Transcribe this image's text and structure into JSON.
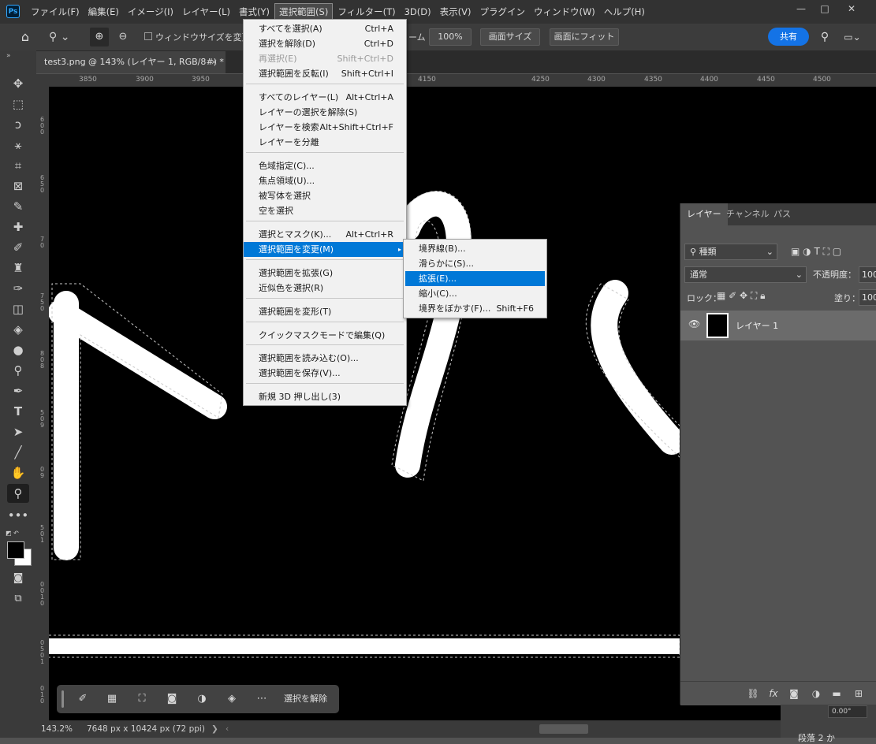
{
  "menubar": {
    "items": [
      "ファイル(F)",
      "編集(E)",
      "イメージ(I)",
      "レイヤー(L)",
      "書式(Y)",
      "選択範囲(S)",
      "フィルター(T)",
      "3D(D)",
      "表示(V)",
      "プラグイン",
      "ウィンドウ(W)",
      "ヘルプ(H)"
    ],
    "window_controls": [
      "—",
      "□",
      "✕"
    ]
  },
  "options": {
    "resize_windows_label": "ウィンドウサイズを変更",
    "truncated_label": "ーム",
    "zoom_value": "100%",
    "fit_screen_label": "画面サイズ",
    "fill_screen_label": "画面にフィット",
    "share_label": "共有"
  },
  "document_tab": {
    "title": "test3.png @ 143% (レイヤー 1, RGB/8#) *",
    "close": "×"
  },
  "ruler": {
    "top": [
      "3850",
      "3900",
      "3950",
      "4150",
      "4250",
      "4300",
      "4350",
      "4400",
      "4450",
      "4500"
    ],
    "left": [
      "6",
      "0",
      "0",
      "6",
      "5",
      "0",
      "7",
      "0",
      "7",
      "5",
      "0",
      "8",
      "0",
      "8",
      "5",
      "0",
      "9",
      "0",
      "9",
      "5",
      "0",
      "1",
      "0",
      "0",
      "1",
      "0",
      "0",
      "5",
      "0",
      "1",
      "0",
      "1",
      "0"
    ]
  },
  "select_menu": {
    "items": [
      {
        "label": "すべてを選択(A)",
        "shortcut": "Ctrl+A"
      },
      {
        "label": "選択を解除(D)",
        "shortcut": "Ctrl+D"
      },
      {
        "label": "再選択(E)",
        "shortcut": "Shift+Ctrl+D"
      },
      {
        "label": "選択範囲を反転(I)",
        "shortcut": "Shift+Ctrl+I"
      },
      {
        "label": "すべてのレイヤー(L)",
        "shortcut": "Alt+Ctrl+A"
      },
      {
        "label": "レイヤーの選択を解除(S)",
        "shortcut": ""
      },
      {
        "label": "レイヤーを検索",
        "shortcut": "Alt+Shift+Ctrl+F"
      },
      {
        "label": "レイヤーを分離",
        "shortcut": ""
      },
      {
        "label": "色域指定(C)...",
        "shortcut": ""
      },
      {
        "label": "焦点領域(U)...",
        "shortcut": ""
      },
      {
        "label": "被写体を選択",
        "shortcut": ""
      },
      {
        "label": "空を選択",
        "shortcut": ""
      },
      {
        "label": "選択とマスク(K)...",
        "shortcut": "Alt+Ctrl+R"
      },
      {
        "label": "選択範囲を変更(M)",
        "shortcut": "▸"
      },
      {
        "label": "選択範囲を拡張(G)",
        "shortcut": ""
      },
      {
        "label": "近似色を選択(R)",
        "shortcut": ""
      },
      {
        "label": "選択範囲を変形(T)",
        "shortcut": ""
      },
      {
        "label": "クイックマスクモードで編集(Q)",
        "shortcut": ""
      },
      {
        "label": "選択範囲を読み込む(O)...",
        "shortcut": ""
      },
      {
        "label": "選択範囲を保存(V)...",
        "shortcut": ""
      },
      {
        "label": "新規 3D 押し出し(3)",
        "shortcut": ""
      }
    ]
  },
  "modify_submenu": {
    "items": [
      {
        "label": "境界線(B)...",
        "shortcut": ""
      },
      {
        "label": "滑らかに(S)...",
        "shortcut": ""
      },
      {
        "label": "拡張(E)...",
        "shortcut": ""
      },
      {
        "label": "縮小(C)...",
        "shortcut": ""
      },
      {
        "label": "境界をぼかす(F)...",
        "shortcut": "Shift+F6"
      }
    ]
  },
  "layers_panel": {
    "tabs": [
      "レイヤー",
      "チャンネル",
      "パス"
    ],
    "filter_kind": "種類",
    "blend_mode": "通常",
    "opacity_label": "不透明度：",
    "opacity_value": "100",
    "lock_label": "ロック：",
    "fill_label": "塗り：",
    "fill_value": "100",
    "layer_name": "レイヤー 1"
  },
  "context_bar": {
    "deselect_label": "選択を解除"
  },
  "status": {
    "zoom": "143.2%",
    "doc_size": "7648 px x 10424 px (72 ppi)",
    "arrow": "❯",
    "scroll_left": "‹"
  },
  "below_panel": {
    "angle_value": "0.00°",
    "truncated_heading": "段落 2 か"
  },
  "icons": [
    "ps-logo-icon",
    "home-icon",
    "zoom-icon",
    "zoom-in-icon",
    "zoom-out-icon",
    "search-icon",
    "workspace-icon",
    "move-icon",
    "marquee-icon",
    "lasso-icon",
    "magic-wand-icon",
    "crop-icon",
    "frame-icon",
    "eyedropper-icon",
    "healing-icon",
    "brush-icon",
    "stamp-icon",
    "history-brush-icon",
    "eraser-icon",
    "bucket-icon",
    "blur-icon",
    "dodge-icon",
    "pen-icon",
    "type-icon",
    "path-select-icon",
    "line-icon",
    "hand-icon",
    "zoom-tool-icon",
    "more-icon",
    "eye-icon",
    "link-icon",
    "fx-icon",
    "mask-icon",
    "adjustment-icon",
    "folder-icon",
    "new-layer-icon",
    "trash-icon"
  ],
  "colors": {
    "highlight": "#0078d7",
    "share": "#1473e6",
    "canvas": "#000000"
  }
}
